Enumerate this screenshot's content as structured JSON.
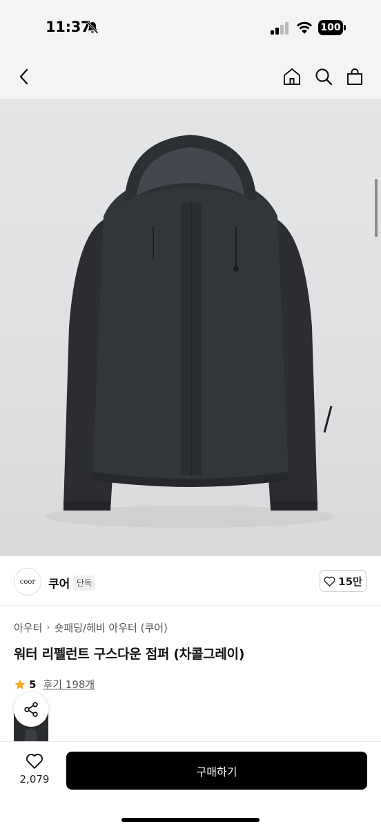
{
  "status": {
    "time": "11:37",
    "battery": "100"
  },
  "brand": {
    "logo_text": "coor",
    "name": "쿠어",
    "badge": "단독",
    "likes": "15만"
  },
  "breadcrumb": {
    "level1": "아우터",
    "level2": "숏패딩/헤비 아우터 (쿠어)"
  },
  "product": {
    "title": "워터 리펠런트 구스다운 점퍼 (차콜그레이)",
    "rating": "5",
    "reviews": "후기 198개"
  },
  "bottom": {
    "wish_count": "2,079",
    "buy_label": "구매하기"
  },
  "colors": {
    "jacket": "#2e3034",
    "star": "#f5a623",
    "buy_button": "#000000",
    "status_bar_bg": "#f4f4f4"
  },
  "icons": [
    "bell-slash-icon",
    "signal-icon",
    "wifi-icon",
    "back-chevron-icon",
    "home-icon",
    "search-icon",
    "cart-icon",
    "heart-icon",
    "star-icon",
    "share-icon"
  ]
}
